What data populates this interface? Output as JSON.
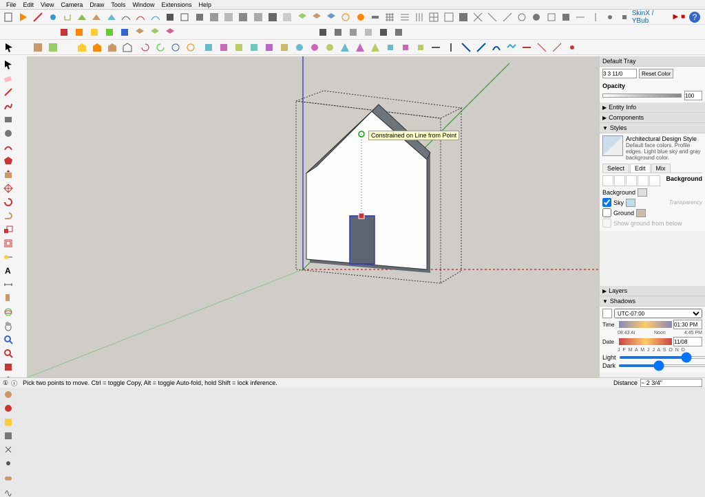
{
  "menu": [
    "File",
    "Edit",
    "View",
    "Camera",
    "Draw",
    "Tools",
    "Window",
    "Extensions",
    "Help"
  ],
  "plugin_label": "SkinX / YBub",
  "tooltip": "Constrained on Line from Point",
  "tray": {
    "title": "Default Tray",
    "reset_color": "Reset Color",
    "opacity_label": "Opacity",
    "opacity_value": "100",
    "entity_info": "Entity Info",
    "components": "Components",
    "styles": "Styles",
    "style_name": "Architectural Design Style",
    "style_desc": "Default face colors. Profile edges. Light blue sky and gray background color.",
    "tabs": {
      "select": "Select",
      "edit": "Edit",
      "mix": "Mix"
    },
    "background_heading": "Background",
    "bg_label": "Background",
    "sky_label": "Sky",
    "ground_label": "Ground",
    "transparency": "Transparency",
    "show_ground": "Show ground from below",
    "layers": "Layers",
    "shadows": "Shadows",
    "tz": "UTC-07:00",
    "time_label": "Time",
    "time_left": "08:43 AI",
    "time_mid": "Noon",
    "time_right": "4:45 PM",
    "time_val": "01:30 PM",
    "date_label": "Date",
    "months": "J F M A M J J A S O N D",
    "date_val": "11/08",
    "light_label": "Light",
    "light_val": "80",
    "dark_label": "Dark",
    "dark_val": "45"
  },
  "status": {
    "hint": "Pick two points to move. Ctrl = toggle Copy, Alt = toggle Auto-fold, hold Shift = lock inference.",
    "distance_label": "Distance",
    "distance_val": "~ 2 3/4\""
  }
}
